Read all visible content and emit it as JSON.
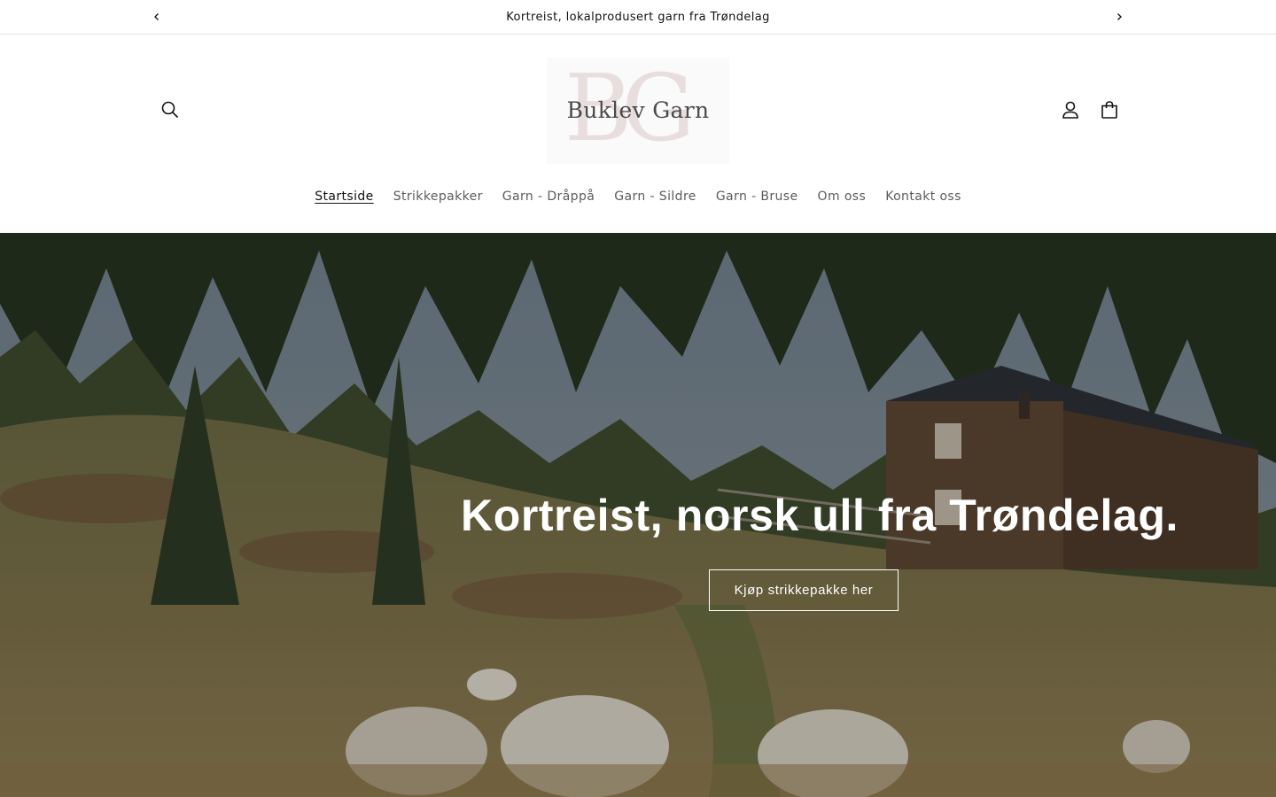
{
  "announcement": {
    "text": "Kortreist, lokalprodusert garn fra Trøndelag",
    "prev_icon": "chevron-left-icon",
    "next_icon": "chevron-right-icon"
  },
  "header": {
    "logo": {
      "monogram": "BG",
      "name": "Buklev Garn"
    },
    "icons": {
      "search": "search-icon",
      "account": "user-icon",
      "cart": "bag-icon"
    },
    "nav": [
      {
        "label": "Startside",
        "active": true
      },
      {
        "label": "Strikkepakker",
        "active": false
      },
      {
        "label": "Garn - Dråppå",
        "active": false
      },
      {
        "label": "Garn - Sildre",
        "active": false
      },
      {
        "label": "Garn - Bruse",
        "active": false
      },
      {
        "label": "Om oss",
        "active": false
      },
      {
        "label": "Kontakt oss",
        "active": false
      }
    ]
  },
  "hero": {
    "heading": "Kortreist, norsk ull fra Trøndelag.",
    "button_label": "Kjøp strikkepakke her"
  },
  "colors": {
    "text": "#121212",
    "nav_inactive": "#5c5c5c",
    "border": "#e6e6e6",
    "hero_text": "#ffffff"
  }
}
